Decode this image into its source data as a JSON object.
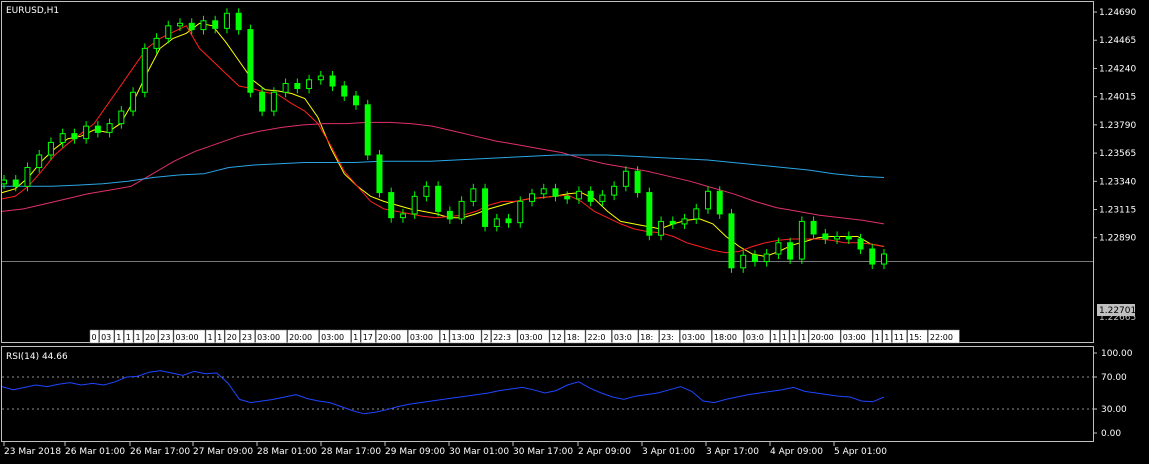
{
  "window": {
    "symbol_timeframe": "EURUSD,H1",
    "rsi_label": "RSI(14) 44.66",
    "current_price": "1.22701",
    "obscured_price": "1.22665"
  },
  "colors": {
    "background": "#000000",
    "frame": "#c0c0c0",
    "candle": "#00ff00",
    "ma_fast": "#ffff00",
    "ma_mid": "#ff2020",
    "ma_slow": "#e0306c",
    "ma_long": "#2aa6e6",
    "rsi_line": "#1e46ff",
    "level_line": "#c0c0c0",
    "price_line": "#c0c0c0",
    "price_label_bg": "#c0c0c0"
  },
  "chart_data": [
    {
      "type": "candlestick",
      "title": "EURUSD,H1",
      "ylim": [
        1.2217,
        1.2477
      ],
      "y_ticks": [
        "1.24690",
        "1.24465",
        "1.24240",
        "1.24015",
        "1.23790",
        "1.23565",
        "1.23340",
        "1.23115",
        "1.22890"
      ],
      "x_ticks": [
        "23 Mar 2018",
        "26 Mar 01:00",
        "26 Mar 17:00",
        "27 Mar 09:00",
        "28 Mar 01:00",
        "28 Mar 17:00",
        "29 Mar 09:00",
        "30 Mar 01:00",
        "30 Mar 17:00",
        "2 Apr 09:00",
        "3 Apr 01:00",
        "3 Apr 17:00",
        "4 Apr 09:00",
        "5 Apr 01:00"
      ],
      "series": [
        {
          "name": "close",
          "values": [
            1.2335,
            1.233,
            1.2345,
            1.2355,
            1.2365,
            1.2372,
            1.2368,
            1.2378,
            1.2373,
            1.238,
            1.239,
            1.2405,
            1.244,
            1.2448,
            1.2458,
            1.246,
            1.2455,
            1.2462,
            1.2456,
            1.2468,
            1.2455,
            1.2405,
            1.239,
            1.2405,
            1.2412,
            1.2408,
            1.2415,
            1.2418,
            1.241,
            1.2402,
            1.2395,
            1.2355,
            1.2325,
            1.2305,
            1.2308,
            1.2322,
            1.233,
            1.231,
            1.2304,
            1.2318,
            1.2328,
            1.2298,
            1.2304,
            1.2301,
            1.2318,
            1.2324,
            1.2328,
            1.2322,
            1.232,
            1.2326,
            1.2318,
            1.2323,
            1.233,
            1.2342,
            1.2325,
            1.2291,
            1.2302,
            1.23,
            1.2304,
            1.2312,
            1.2326,
            1.2308,
            1.2265,
            1.2275,
            1.227,
            1.2276,
            1.2285,
            1.2272,
            1.2302,
            1.2292,
            1.2288,
            1.229,
            1.2288,
            1.228,
            1.2268,
            1.2276
          ]
        },
        {
          "name": "ma_fast",
          "values": [
            1.2325,
            1.2328,
            1.2337,
            1.235,
            1.236,
            1.2368,
            1.237,
            1.2375,
            1.2373,
            1.238,
            1.2398,
            1.242,
            1.244,
            1.2448,
            1.2452,
            1.246,
            1.2458,
            1.2445,
            1.243,
            1.2415,
            1.2407,
            1.2406,
            1.2404,
            1.24,
            1.2385,
            1.236,
            1.234,
            1.233,
            1.2322,
            1.2318,
            1.2315,
            1.2312,
            1.231,
            1.2308,
            1.2305,
            1.2305,
            1.2308,
            1.2312,
            1.2315,
            1.2318,
            1.232,
            1.2321,
            1.2322,
            1.2324,
            1.2325,
            1.232,
            1.231,
            1.2302,
            1.23,
            1.2298,
            1.2296,
            1.23,
            1.2303,
            1.2304,
            1.23,
            1.229,
            1.2282,
            1.2276,
            1.2274,
            1.2278,
            1.2283,
            1.2286,
            1.2289,
            1.229,
            1.229,
            1.229,
            1.2284,
            1.2282
          ]
        },
        {
          "name": "ma_mid",
          "values": [
            1.232,
            1.2322,
            1.233,
            1.2342,
            1.2355,
            1.2364,
            1.2372,
            1.238,
            1.2395,
            1.241,
            1.2425,
            1.244,
            1.2448,
            1.2453,
            1.2458,
            1.244,
            1.243,
            1.242,
            1.241,
            1.2408,
            1.2405,
            1.2403,
            1.2396,
            1.239,
            1.238,
            1.2362,
            1.2342,
            1.233,
            1.2318,
            1.2312,
            1.231,
            1.2308,
            1.2306,
            1.2305,
            1.2306,
            1.2307,
            1.231,
            1.2315,
            1.2318,
            1.2318,
            1.232,
            1.2321,
            1.2322,
            1.2323,
            1.2318,
            1.231,
            1.2305,
            1.23,
            1.2296,
            1.2294,
            1.2293,
            1.229,
            1.2285,
            1.2282,
            1.2279,
            1.2277,
            1.2278,
            1.2282,
            1.2285,
            1.2287,
            1.2288,
            1.2288,
            1.2288,
            1.2287,
            1.2285,
            1.2285,
            1.2284,
            1.2282
          ]
        },
        {
          "name": "ma_slow",
          "values": [
            1.231,
            1.2312,
            1.2316,
            1.232,
            1.2324,
            1.2327,
            1.233,
            1.234,
            1.235,
            1.2358,
            1.2364,
            1.237,
            1.2374,
            1.2377,
            1.2379,
            1.238,
            1.238,
            1.2381,
            1.2381,
            1.238,
            1.2378,
            1.2374,
            1.237,
            1.2366,
            1.2363,
            1.236,
            1.2357,
            1.2352,
            1.2348,
            1.2345,
            1.2342,
            1.2338,
            1.2334,
            1.2329,
            1.2324,
            1.2318,
            1.2313,
            1.231,
            1.2307,
            1.2305,
            1.2303,
            1.23
          ]
        },
        {
          "name": "ma_long",
          "values": [
            1.233,
            1.233,
            1.233,
            1.2331,
            1.2332,
            1.2334,
            1.2337,
            1.2339,
            1.234,
            1.2345,
            1.2347,
            1.2348,
            1.2349,
            1.2349,
            1.2349,
            1.235,
            1.235,
            1.235,
            1.2351,
            1.2352,
            1.2353,
            1.2354,
            1.2355,
            1.2355,
            1.2355,
            1.2354,
            1.2353,
            1.2352,
            1.2351,
            1.2349,
            1.2347,
            1.2345,
            1.2343,
            1.234,
            1.2338,
            1.2337
          ]
        }
      ]
    },
    {
      "type": "line",
      "title": "RSI(14) 44.66",
      "ylim": [
        0,
        100
      ],
      "y_ticks": [
        "100.00",
        "70.00",
        "30.00",
        "0.00"
      ],
      "levels": [
        70,
        30
      ],
      "series": [
        {
          "name": "rsi",
          "values": [
            58,
            54,
            57,
            60,
            58,
            61,
            63,
            60,
            62,
            60,
            64,
            70,
            71,
            76,
            78,
            75,
            72,
            77,
            74,
            75,
            62,
            42,
            38,
            40,
            42,
            45,
            48,
            43,
            40,
            38,
            33,
            28,
            24,
            26,
            29,
            33,
            36,
            38,
            40,
            42,
            44,
            46,
            48,
            50,
            53,
            55,
            57,
            54,
            50,
            53,
            60,
            64,
            56,
            50,
            45,
            42,
            46,
            48,
            50,
            54,
            58,
            52,
            40,
            38,
            42,
            45,
            48,
            50,
            52,
            54,
            57,
            52,
            50,
            48,
            46,
            45,
            40,
            39,
            45
          ]
        }
      ]
    }
  ],
  "time_scale_labels": [
    "0",
    "03",
    "1",
    "1",
    "1",
    "20",
    "23",
    "03:00",
    "1",
    "1",
    "20",
    "23",
    "03:00",
    "20:00",
    "03:00",
    "1",
    "17",
    "20:00",
    "03:00",
    "1",
    "13:00",
    "2",
    "22:3",
    "03:00",
    "12",
    "18:",
    "22:0",
    "03:0",
    "18:",
    "23:",
    "03:00",
    "18:00",
    "03:0",
    "1",
    "1",
    "1",
    "1",
    "20:00",
    "03:00",
    "1",
    "1",
    "11",
    "15:",
    "22:00"
  ]
}
